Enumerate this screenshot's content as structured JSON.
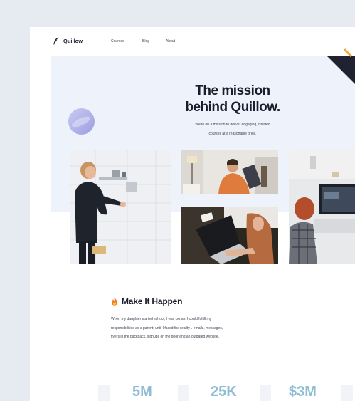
{
  "nav": {
    "brand": "Quillow",
    "links": [
      "Courses",
      "Blog",
      "About"
    ]
  },
  "hero": {
    "title_line1": "The mission",
    "title_line2": "behind Quillow.",
    "subtitle_line1": "We're on a mission to deliver engaging, curated",
    "subtitle_line2": "courses at a reasonable price."
  },
  "section": {
    "icon": "fire-icon",
    "title": "Make It Happen",
    "body_lines": [
      "When my daughter started school, I was certain I could fulfill my",
      "responsibilities as a parent; until I faced the reality... emails, messages,",
      "flyers in the backpack, signups on the door and an outdated website."
    ]
  },
  "stats": [
    "5M",
    "25K",
    "$3M"
  ],
  "colors": {
    "page_bg": "#e6eaf1",
    "hero_bg": "#eef2fb",
    "stat_text": "#8fbdd3",
    "accent_dark": "#1f2230"
  }
}
